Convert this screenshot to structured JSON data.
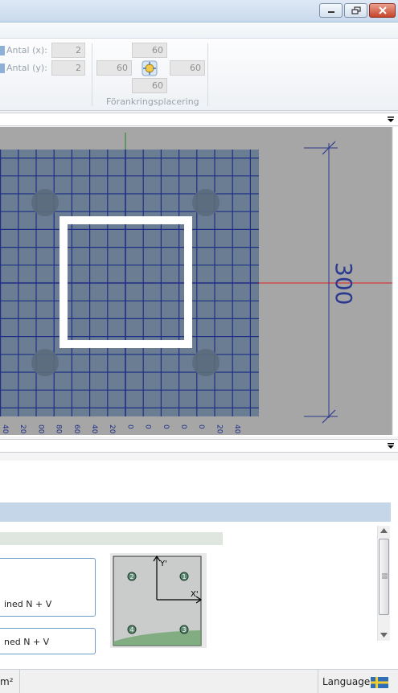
{
  "ribbon": {
    "antal_x_label": "Antal (x):",
    "antal_x_value": "2",
    "antal_y_label": "Antal (y):",
    "antal_y_value": "2",
    "placement": {
      "top": "60",
      "left": "60",
      "right": "60",
      "bottom": "60"
    },
    "group_label": "Förankringsplacering"
  },
  "canvas": {
    "dimension_label": "300",
    "tick_labels": [
      "40",
      "20",
      "00",
      "80",
      "60",
      "40",
      "20",
      "0",
      "0",
      "0",
      "0",
      "0",
      "20",
      "40"
    ]
  },
  "load_buttons": {
    "combined_1": "ined N + V",
    "combined_2": "ned N + V"
  },
  "preview": {
    "axis_y": "Y'",
    "axis_x": "X'",
    "anchors": [
      "2",
      "1",
      "4",
      "3"
    ]
  },
  "statusbar": {
    "unit": "m²",
    "language_label": "Language:"
  },
  "colors": {
    "plate": "#6b7d92",
    "grid": "#1f2f86",
    "column": "#ffffff",
    "dimension": "#2b3a8e",
    "axis_red": "#e02020",
    "axis_green": "#2e8b3c"
  },
  "icons": {
    "minimize": "minimize-icon",
    "maximize": "restore-icon",
    "close": "close-icon",
    "dropdown": "dropdown-arrow-icon",
    "placement": "anchor-placement-icon",
    "language": "swedish-flag-icon"
  }
}
